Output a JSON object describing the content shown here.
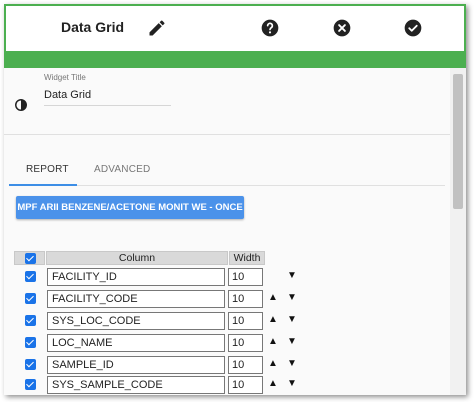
{
  "header": {
    "title": "Data Grid",
    "icons": [
      "pencil-icon",
      "help-icon",
      "close-circle-icon",
      "check-circle-icon"
    ],
    "accent_color": "#4caf50"
  },
  "widget_title": {
    "label": "Widget Title",
    "value": "Data Grid"
  },
  "tabs": [
    {
      "label": "REPORT",
      "active": true
    },
    {
      "label": "ADVANCED",
      "active": false
    }
  ],
  "report_button": {
    "label": "MPF ARII BENZENE/ACETONE MONIT WE - ONCE",
    "color": "#4b92ea"
  },
  "grid": {
    "headers": {
      "column": "Column",
      "width": "Width"
    },
    "select_all_checked": true,
    "rows": [
      {
        "column": "FACILITY_ID",
        "width": "10",
        "checked": true,
        "up": false,
        "down": true
      },
      {
        "column": "FACILITY_CODE",
        "width": "10",
        "checked": true,
        "up": true,
        "down": true
      },
      {
        "column": "SYS_LOC_CODE",
        "width": "10",
        "checked": true,
        "up": true,
        "down": true
      },
      {
        "column": "LOC_NAME",
        "width": "10",
        "checked": true,
        "up": true,
        "down": true
      },
      {
        "column": "SAMPLE_ID",
        "width": "10",
        "checked": true,
        "up": true,
        "down": true
      },
      {
        "column": "SYS_SAMPLE_CODE",
        "width": "10",
        "checked": true,
        "up": true,
        "down": true
      }
    ],
    "arrow_up": "▲",
    "arrow_down": "▼"
  }
}
